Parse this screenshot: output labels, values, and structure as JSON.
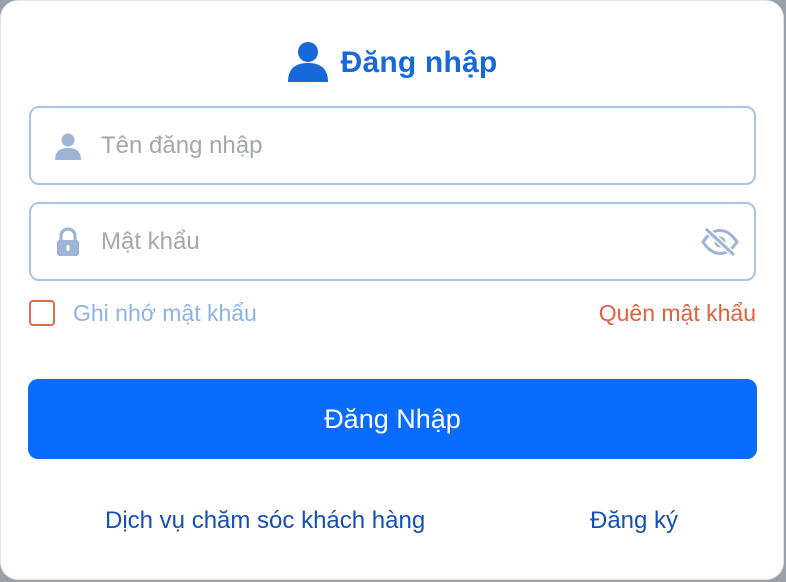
{
  "header": {
    "title": "Đăng nhập",
    "icon": "user-icon"
  },
  "username": {
    "placeholder": "Tên đăng nhập",
    "value": "",
    "icon": "user-icon"
  },
  "password": {
    "placeholder": "Mật khẩu",
    "value": "",
    "icon": "lock-icon",
    "toggle_icon": "eye-slash-icon"
  },
  "options": {
    "remember_label": "Ghi nhớ mật khẩu",
    "remember_checked": false,
    "forgot_label": "Quên mật khẩu"
  },
  "login_button": {
    "label": "Đăng Nhập"
  },
  "footer": {
    "support_label": "Dịch vụ chăm sóc khách hàng",
    "register_label": "Đăng ký"
  },
  "colors": {
    "primary": "#0a6cff",
    "title": "#1769d9",
    "field_border": "#a9c4ea",
    "icon": "#8fa9cf",
    "accent_red": "#e0613f",
    "link": "#1450b4"
  }
}
